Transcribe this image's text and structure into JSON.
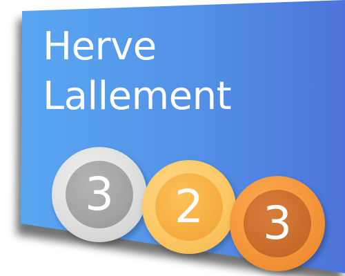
{
  "profile": {
    "first_name": "Herve",
    "last_name": "Lallement"
  },
  "medals": {
    "silver": {
      "count": "3",
      "color": "#a3a3a3"
    },
    "gold": {
      "count": "2",
      "color": "#f6ae41"
    },
    "bronze": {
      "count": "3",
      "color": "#c96d2c"
    }
  },
  "colors": {
    "card_left": "#5aa4f0",
    "card_right": "#4f79dc",
    "text": "#ffffff"
  }
}
